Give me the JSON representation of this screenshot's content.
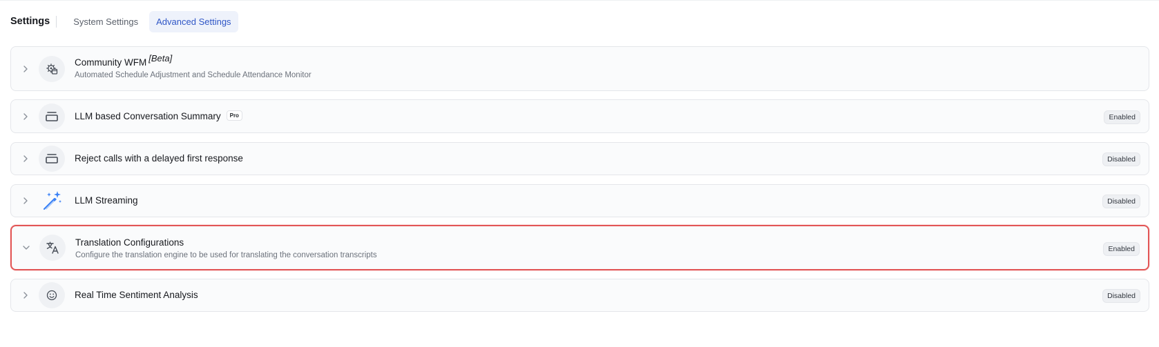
{
  "header": {
    "title": "Settings",
    "tabs": [
      {
        "label": "System Settings",
        "active": false
      },
      {
        "label": "Advanced Settings",
        "active": true
      }
    ]
  },
  "accent_color": "#2f56c6",
  "highlight_color": "#e25555",
  "cards": [
    {
      "title": "Community WFM",
      "tag": "[Beta]",
      "description": "Automated Schedule Adjustment and Schedule Attendance Monitor",
      "icon": "gear-schedule-icon",
      "expanded": false
    },
    {
      "title": "LLM based Conversation Summary",
      "badge": "Pro",
      "status": "Enabled",
      "icon": "panel-icon",
      "expanded": false
    },
    {
      "title": "Reject calls with a delayed first response",
      "status": "Disabled",
      "icon": "panel-icon",
      "expanded": false
    },
    {
      "title": "LLM Streaming",
      "status": "Disabled",
      "icon": "magic-wand-icon",
      "expanded": false
    },
    {
      "title": "Translation Configurations",
      "description": "Configure the translation engine to be used for translating the conversation transcripts",
      "status": "Enabled",
      "icon": "translate-icon",
      "expanded": true,
      "highlighted": true
    },
    {
      "title": "Real Time Sentiment Analysis",
      "status": "Disabled",
      "icon": "smiley-icon",
      "expanded": false
    }
  ]
}
